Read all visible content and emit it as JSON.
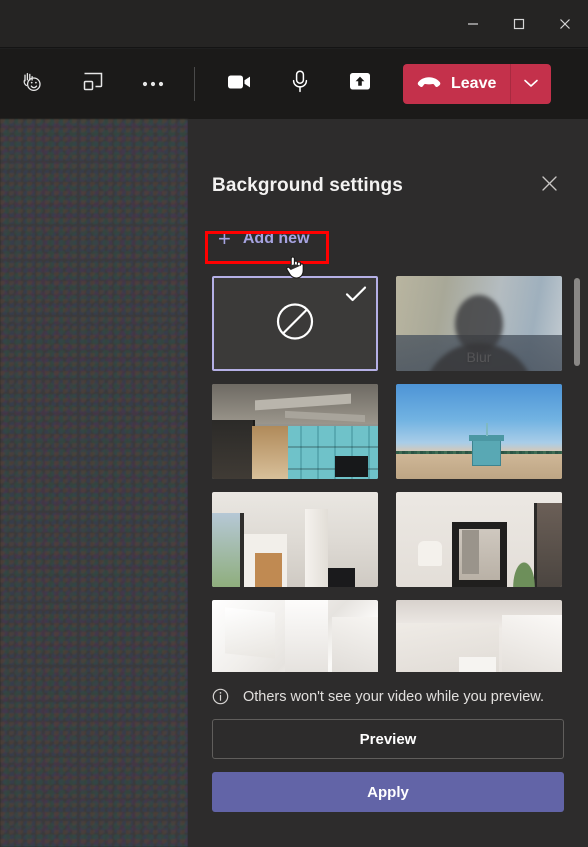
{
  "window": {
    "controls": [
      {
        "name": "minimize",
        "glyph": "minimize-icon"
      },
      {
        "name": "maximize",
        "glyph": "maximize-icon"
      },
      {
        "name": "close",
        "glyph": "close-icon"
      }
    ]
  },
  "toolbar": {
    "icons": [
      {
        "name": "raise-hand-reactions-icon",
        "label": "Reactions"
      },
      {
        "name": "rooms-icon",
        "label": "Rooms"
      },
      {
        "name": "more-options-icon",
        "label": "More actions"
      },
      {
        "name": "camera-icon",
        "label": "Camera"
      },
      {
        "name": "microphone-icon",
        "label": "Mic"
      },
      {
        "name": "share-screen-icon",
        "label": "Share"
      }
    ],
    "leave_label": "Leave",
    "leave_color": "#c4314b"
  },
  "panel": {
    "title": "Background settings",
    "close_label": "Close",
    "add_new_label": "Add new",
    "add_new_accent": "#a6a3e0",
    "annotation_color": "#ff0000",
    "thumbnails": [
      {
        "id": "none",
        "label": "",
        "art": "none",
        "selected": true,
        "checked": true
      },
      {
        "id": "blur",
        "label": "Blur",
        "art": "blur",
        "selected": false,
        "checked": false
      },
      {
        "id": "office",
        "label": "",
        "art": "office",
        "selected": false,
        "checked": false
      },
      {
        "id": "beach",
        "label": "",
        "art": "beach",
        "selected": false,
        "checked": false
      },
      {
        "id": "room1",
        "label": "",
        "art": "room1",
        "selected": false,
        "checked": false
      },
      {
        "id": "room2",
        "label": "",
        "art": "room2",
        "selected": false,
        "checked": false
      },
      {
        "id": "white1",
        "label": "",
        "art": "white1",
        "selected": false,
        "checked": false
      },
      {
        "id": "white2",
        "label": "",
        "art": "white2",
        "selected": false,
        "checked": false
      }
    ],
    "note": "Others won't see your video while you preview.",
    "preview_label": "Preview",
    "apply_label": "Apply",
    "apply_color": "#6264a7"
  }
}
